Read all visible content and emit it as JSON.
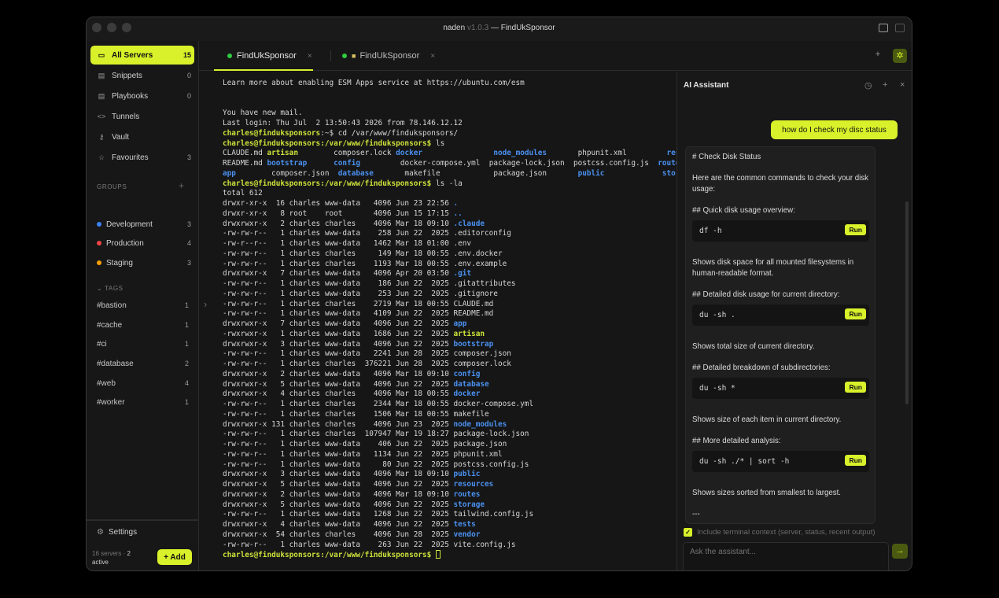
{
  "window": {
    "app_name": "naden",
    "version": "v1.0.3",
    "title_sep": "— FindUkSponsor"
  },
  "sidebar": {
    "all_servers": {
      "label": "All Servers",
      "count": "15"
    },
    "snippets": {
      "label": "Snippets",
      "count": "0"
    },
    "playbooks": {
      "label": "Playbooks",
      "count": "0"
    },
    "tunnels": {
      "label": "Tunnels"
    },
    "vault": {
      "label": "Vault"
    },
    "favourites": {
      "label": "Favourites",
      "count": "3"
    },
    "groups_header": "GROUPS",
    "groups": [
      {
        "label": "Development",
        "count": "3",
        "color": "#3b82f6"
      },
      {
        "label": "Production",
        "count": "4",
        "color": "#ef4444"
      },
      {
        "label": "Staging",
        "count": "3",
        "color": "#f59e0b"
      }
    ],
    "tags_header": "TAGS",
    "tags": [
      {
        "label": "#bastion",
        "count": "1"
      },
      {
        "label": "#cache",
        "count": "1"
      },
      {
        "label": "#ci",
        "count": "1"
      },
      {
        "label": "#database",
        "count": "2"
      },
      {
        "label": "#web",
        "count": "4"
      },
      {
        "label": "#worker",
        "count": "1"
      }
    ],
    "settings_label": "Settings",
    "footer_servers": "16 servers ·",
    "footer_active_num": "2",
    "footer_active": "active",
    "add_label": "+ Add"
  },
  "tabs": [
    {
      "label": "FindUkSponsor"
    },
    {
      "label": "FindUkSponsor"
    }
  ],
  "terminal": {
    "lines": [
      "Learn more about enabling ESM Apps service at https://ubuntu.com/esm",
      "",
      "",
      "You have new mail.",
      "Last login: Thu Jul  2 13:50:43 2026 from 78.146.12.12"
    ],
    "prompt_user": "charles@finduksponsors",
    "prompt_home": ":~$ cd /var/www/finduksponsors/",
    "prompt_path": ":/var/www/finduksponsors$ ",
    "cmd_ls": "ls",
    "cmd_lsla": "ls -la",
    "ls_rows": [
      [
        [
          "CLAUDE.md ",
          ""
        ],
        [
          "artisan",
          "y"
        ],
        [
          "        composer.lock ",
          ""
        ],
        [
          "docker",
          "b"
        ],
        [
          "                ",
          ""
        ],
        [
          "node_modules",
          "b"
        ],
        [
          "       phpunit.xml         ",
          ""
        ],
        [
          "resou",
          "b"
        ]
      ],
      [
        [
          "README.md ",
          ""
        ],
        [
          "bootstrap",
          "b"
        ],
        [
          "      ",
          ""
        ],
        [
          "config",
          "b"
        ],
        [
          "         docker-compose.yml  package-lock.json  postcss.config.js  ",
          ""
        ],
        [
          "route",
          "b"
        ]
      ],
      [
        [
          "app",
          "b"
        ],
        [
          "        composer.json  ",
          ""
        ],
        [
          "database",
          "b"
        ],
        [
          "       makefile            package.json       ",
          ""
        ],
        [
          "public",
          "b"
        ],
        [
          "             ",
          ""
        ],
        [
          "stora",
          "b"
        ]
      ]
    ],
    "total": "total 612",
    "la_rows": [
      [
        "drwxr-xr-x  16 charles www-data   4096 Jun 23 22:56 ",
        ".",
        "b"
      ],
      [
        "drwxr-xr-x   8 root    root       4096 Jun 15 17:15 ",
        "..",
        "b"
      ],
      [
        "drwxrwxr-x   2 charles charles    4096 Mar 18 09:10 ",
        ".claude",
        "b"
      ],
      [
        "-rw-rw-r--   1 charles www-data    258 Jun 22  2025 ",
        ".editorconfig",
        ""
      ],
      [
        "-rw-r--r--   1 charles www-data   1462 Mar 18 01:00 ",
        ".env",
        ""
      ],
      [
        "-rw-rw-r--   1 charles charles     149 Mar 18 00:55 ",
        ".env.docker",
        ""
      ],
      [
        "-rw-rw-r--   1 charles charles    1193 Mar 18 00:55 ",
        ".env.example",
        ""
      ],
      [
        "drwxrwxr-x   7 charles www-data   4096 Apr 20 03:50 ",
        ".git",
        "b"
      ],
      [
        "-rw-rw-r--   1 charles www-data    186 Jun 22  2025 ",
        ".gitattributes",
        ""
      ],
      [
        "-rw-rw-r--   1 charles www-data    253 Jun 22  2025 ",
        ".gitignore",
        ""
      ],
      [
        "-rw-rw-r--   1 charles charles    2719 Mar 18 00:55 ",
        "CLAUDE.md",
        ""
      ],
      [
        "-rw-rw-r--   1 charles www-data   4109 Jun 22  2025 ",
        "README.md",
        ""
      ],
      [
        "drwxrwxr-x   7 charles www-data   4096 Jun 22  2025 ",
        "app",
        "b"
      ],
      [
        "-rwxrwxr-x   1 charles www-data   1686 Jun 22  2025 ",
        "artisan",
        "y"
      ],
      [
        "drwxrwxr-x   3 charles www-data   4096 Jun 22  2025 ",
        "bootstrap",
        "b"
      ],
      [
        "-rw-rw-r--   1 charles www-data   2241 Jun 28  2025 ",
        "composer.json",
        ""
      ],
      [
        "-rw-rw-r--   1 charles charles  376221 Jun 28  2025 ",
        "composer.lock",
        ""
      ],
      [
        "drwxrwxr-x   2 charles www-data   4096 Mar 18 09:10 ",
        "config",
        "b"
      ],
      [
        "drwxrwxr-x   5 charles www-data   4096 Jun 22  2025 ",
        "database",
        "b"
      ],
      [
        "drwxrwxr-x   4 charles charles    4096 Mar 18 00:55 ",
        "docker",
        "b"
      ],
      [
        "-rw-rw-r--   1 charles charles    2344 Mar 18 00:55 ",
        "docker-compose.yml",
        ""
      ],
      [
        "-rw-rw-r--   1 charles charles    1506 Mar 18 00:55 ",
        "makefile",
        ""
      ],
      [
        "drwxrwxr-x 131 charles charles    4096 Jun 23  2025 ",
        "node_modules",
        "b"
      ],
      [
        "-rw-rw-r--   1 charles charles  107947 Mar 19 18:27 ",
        "package-lock.json",
        ""
      ],
      [
        "-rw-rw-r--   1 charles www-data    406 Jun 22  2025 ",
        "package.json",
        ""
      ],
      [
        "-rw-rw-r--   1 charles www-data   1134 Jun 22  2025 ",
        "phpunit.xml",
        ""
      ],
      [
        "-rw-rw-r--   1 charles www-data     80 Jun 22  2025 ",
        "postcss.config.js",
        ""
      ],
      [
        "drwxrwxr-x   3 charles www-data   4096 Mar 18 09:10 ",
        "public",
        "b"
      ],
      [
        "drwxrwxr-x   5 charles www-data   4096 Jun 22  2025 ",
        "resources",
        "b"
      ],
      [
        "drwxrwxr-x   2 charles www-data   4096 Mar 18 09:10 ",
        "routes",
        "b"
      ],
      [
        "drwxrwxr-x   5 charles www-data   4096 Jun 22  2025 ",
        "storage",
        "b"
      ],
      [
        "-rw-rw-r--   1 charles www-data   1268 Jun 22  2025 ",
        "tailwind.config.js",
        ""
      ],
      [
        "drwxrwxr-x   4 charles www-data   4096 Jun 22  2025 ",
        "tests",
        "b"
      ],
      [
        "drwxrwxr-x  54 charles charles    4096 Jun 28  2025 ",
        "vendor",
        "b"
      ],
      [
        "-rw-rw-r--   1 charles www-data    263 Jun 22  2025 ",
        "vite.config.js",
        ""
      ]
    ]
  },
  "assistant": {
    "title": "AI Assistant",
    "user_message": "how do I check my disc status",
    "response": {
      "heading": "# Check Disk Status",
      "intro": "Here are the common commands to check your disk usage:",
      "sections": [
        {
          "title": "## Quick disk usage overview:",
          "code": "df -h",
          "desc": "Shows disk space for all mounted filesystems in human-readable format."
        },
        {
          "title": "## Detailed disk usage for current directory:",
          "code": "du -sh .",
          "desc": "Shows total size of current directory."
        },
        {
          "title": "## Detailed breakdown of subdirectories:",
          "code": "du -sh *",
          "desc": "Shows size of each item in current directory."
        },
        {
          "title": "## More detailed analysis:",
          "code": "du -sh ./* | sort -h",
          "desc": "Shows sizes sorted from smallest to largest."
        }
      ],
      "rule": "---",
      "run_label": "Run"
    },
    "context_label": "Include terminal context (server, status, recent output)",
    "input_placeholder": "Ask the assistant..."
  },
  "colors": {
    "accent": "#d8f12a",
    "dir_blue": "#4a90f0",
    "online_green": "#2ecc40"
  }
}
